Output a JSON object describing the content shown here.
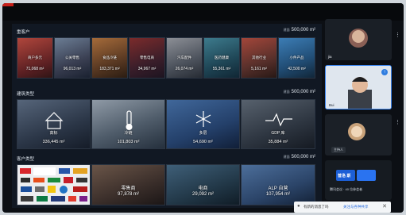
{
  "sections": {
    "retail": {
      "title": "重客户",
      "area_prefix": "建面",
      "area": "500,000 m²",
      "tiles": [
        {
          "label": "商户多元",
          "value": "71,068 m²"
        },
        {
          "label": "公关零售",
          "value": "96,013 m²"
        },
        {
          "label": "食品冷链",
          "value": "183,371 m²"
        },
        {
          "label": "零售电商",
          "value": "34,967 m²"
        },
        {
          "label": "汽车配件",
          "value": "26,074 m²"
        },
        {
          "label": "医药健康",
          "value": "55,361 m²"
        },
        {
          "label": "其他行业",
          "value": "5,161 m²"
        },
        {
          "label": "小件产品",
          "value": "42,500 m²"
        }
      ]
    },
    "types": {
      "title": "建筑类型",
      "area_prefix": "建面",
      "area": "500,000 m²",
      "tiles": [
        {
          "label": "高标",
          "value": "336,445 m²"
        },
        {
          "label": "冷链",
          "value": "101,803 m²"
        },
        {
          "label": "多层",
          "value": "54,690 m²"
        },
        {
          "label": "GDP 库",
          "value": "35,884 m²"
        }
      ]
    },
    "customers": {
      "title": "客户类型",
      "area_prefix": "建面",
      "area": "500,000 m²",
      "tiles": [
        {
          "label": "",
          "value": ""
        },
        {
          "label": "零售商",
          "value": "97,878 m²"
        },
        {
          "label": "电商",
          "value": "29,092 m²"
        },
        {
          "label": "ALP 自营",
          "value": "107,954 m²"
        }
      ]
    }
  },
  "participants": [
    {
      "name": "jia",
      "badge": ""
    },
    {
      "name": "Bui",
      "badge": "↑"
    },
    {
      "name": "大窗",
      "badge": ""
    },
    {
      "name": "",
      "badge": ""
    }
  ],
  "host_chip": "主持人",
  "meeting_caption": "腾讯会议 · 40 位参会者",
  "logo_text": "普洛 斯",
  "toast": {
    "message": "有新的消息了吗",
    "link": "关注与各种共享",
    "close": "✕"
  },
  "colors": {
    "record": "#c8201a",
    "accent": "#2f7de0"
  }
}
